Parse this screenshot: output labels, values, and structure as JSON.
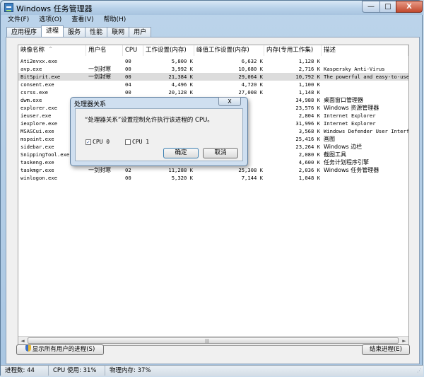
{
  "window": {
    "title": "Windows 任务管理器",
    "min_glyph": "—",
    "max_glyph": "□",
    "close_glyph": "X"
  },
  "menu": [
    "文件(F)",
    "选项(O)",
    "查看(V)",
    "帮助(H)"
  ],
  "tabs": [
    {
      "label": "应用程序",
      "active": false
    },
    {
      "label": "进程",
      "active": true
    },
    {
      "label": "服务",
      "active": false
    },
    {
      "label": "性能",
      "active": false
    },
    {
      "label": "联网",
      "active": false
    },
    {
      "label": "用户",
      "active": false
    }
  ],
  "columns": [
    "映像名称",
    "用户名",
    "CPU",
    "工作设置(内存)",
    "峰值工作设置(内存)",
    "内存(专用工作集)",
    "描述"
  ],
  "sort_glyph": "^",
  "processes": [
    {
      "name": "Ati2evxx.exe",
      "user": "",
      "cpu": "00",
      "ws": "5,800 K",
      "peak": "6,632 K",
      "priv": "1,128 K",
      "desc": ""
    },
    {
      "name": "avp.exe",
      "user": "一剑封寒",
      "cpu": "00",
      "ws": "3,992 K",
      "peak": "10,680 K",
      "priv": "2,716 K",
      "desc": "Kaspersky Anti-Virus"
    },
    {
      "name": "BitSpirit.exe",
      "user": "一剑封寒",
      "cpu": "00",
      "ws": "21,384 K",
      "peak": "29,064 K",
      "priv": "10,792 K",
      "desc": "The powerful and easy-to-use BitTo"
    },
    {
      "name": "consent.exe",
      "user": "",
      "cpu": "04",
      "ws": "4,496 K",
      "peak": "4,720 K",
      "priv": "1,100 K",
      "desc": ""
    },
    {
      "name": "csrss.exe",
      "user": "",
      "cpu": "00",
      "ws": "20,128 K",
      "peak": "27,008 K",
      "priv": "1,148 K",
      "desc": ""
    },
    {
      "name": "dwm.exe",
      "user": "",
      "cpu": "",
      "ws": "",
      "peak": "",
      "priv": "34,988 K",
      "desc": "桌面窗口管理器"
    },
    {
      "name": "explorer.exe",
      "user": "",
      "cpu": "",
      "ws": "",
      "peak": "",
      "priv": "23,576 K",
      "desc": "Windows 资源管理器"
    },
    {
      "name": "ieuser.exe",
      "user": "",
      "cpu": "",
      "ws": "",
      "peak": "",
      "priv": "2,804 K",
      "desc": "Internet Explorer"
    },
    {
      "name": "iexplore.exe",
      "user": "",
      "cpu": "",
      "ws": "",
      "peak": "",
      "priv": "31,996 K",
      "desc": "Internet Explorer"
    },
    {
      "name": "MSASCui.exe",
      "user": "",
      "cpu": "",
      "ws": "",
      "peak": "",
      "priv": "3,568 K",
      "desc": "Windows Defender User Interface"
    },
    {
      "name": "mspaint.exe",
      "user": "",
      "cpu": "",
      "ws": "",
      "peak": "",
      "priv": "25,416 K",
      "desc": "画图"
    },
    {
      "name": "sidebar.exe",
      "user": "",
      "cpu": "",
      "ws": "",
      "peak": "",
      "priv": "23,264 K",
      "desc": "Windows 边栏"
    },
    {
      "name": "SnippingTool.exe",
      "user": "",
      "cpu": "",
      "ws": "",
      "peak": "",
      "priv": "2,080 K",
      "desc": "截图工具"
    },
    {
      "name": "taskeng.exe",
      "user": "",
      "cpu": "",
      "ws": "",
      "peak": "",
      "priv": "4,600 K",
      "desc": "任务计划程序引擎"
    },
    {
      "name": "taskmgr.exe",
      "user": "一剑封寒",
      "cpu": "02",
      "ws": "11,288 K",
      "peak": "25,308 K",
      "priv": "2,036 K",
      "desc": "Windows 任务管理器"
    },
    {
      "name": "winlogon.exe",
      "user": "",
      "cpu": "00",
      "ws": "5,320 K",
      "peak": "7,144 K",
      "priv": "1,048 K",
      "desc": ""
    }
  ],
  "scrollbar": {
    "left_glyph": "◄",
    "right_glyph": "►",
    "grip_glyph": "|||"
  },
  "show_all_button": "显示所有用户的进程(S)",
  "end_process_button": "结束进程(E)",
  "status": {
    "processes": "进程数: 44",
    "cpu": "CPU 使用: 31%",
    "memory": "物理内存: 37%"
  },
  "resize_glyph": "⋰",
  "dialog": {
    "title": "处理器关系",
    "close_glyph": "X",
    "message": "“处理器关系”设置控制允许执行该进程的 CPU。",
    "cpu0": {
      "label": "CPU 0",
      "checked": true,
      "mark": "✓"
    },
    "cpu1": {
      "label": "CPU 1",
      "checked": false,
      "mark": ""
    },
    "ok": "确定",
    "cancel": "取消"
  }
}
